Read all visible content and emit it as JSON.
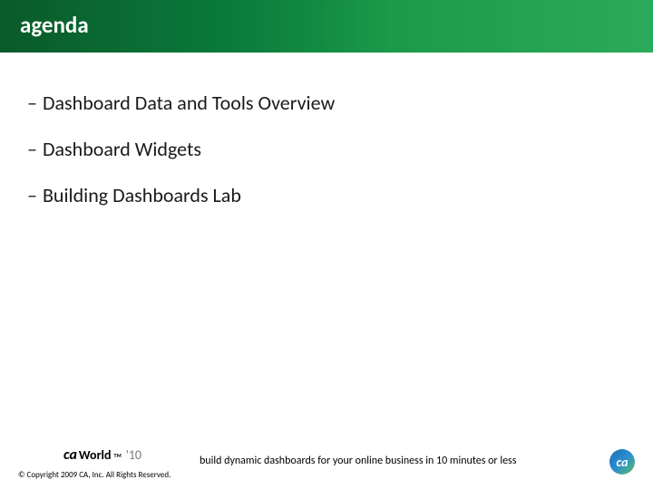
{
  "header": {
    "title": "agenda"
  },
  "bullets": {
    "items": [
      {
        "text": "Dashboard Data and Tools Overview"
      },
      {
        "text": "Dashboard Widgets"
      },
      {
        "text": "Building Dashboards Lab"
      }
    ]
  },
  "footer": {
    "world_logo": {
      "ca": "ca",
      "world": "World",
      "tm": "TM",
      "year": "'10"
    },
    "copyright": "© Copyright 2009 CA, Inc. All Rights Reserved.",
    "tagline": "build dynamic dashboards for your online business in 10 minutes or less",
    "ca_logo_text": "ca"
  }
}
